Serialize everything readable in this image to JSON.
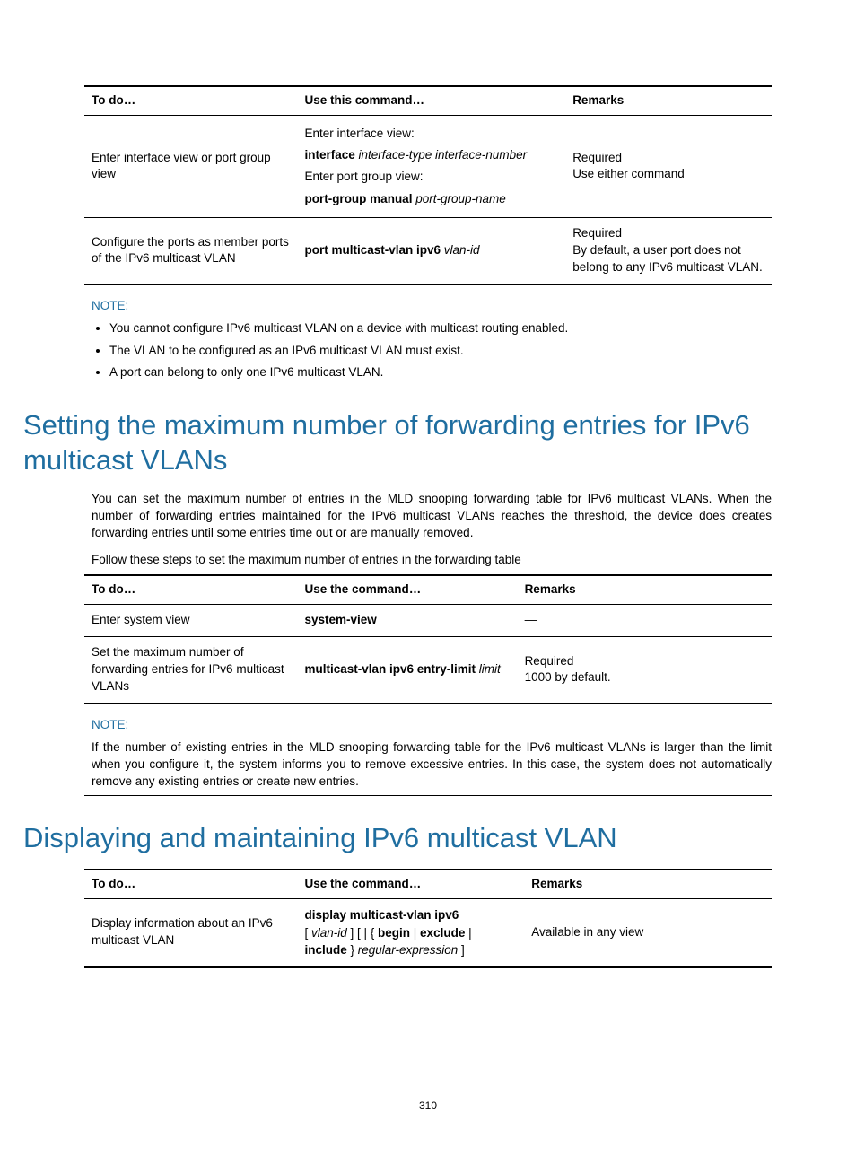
{
  "table1": {
    "headers": {
      "c1": "To do…",
      "c2": "Use this command…",
      "c3": "Remarks"
    },
    "row1": {
      "todo": "Enter interface view or port group view",
      "cmd_line1": "Enter interface view:",
      "cmd_bold2": "interface",
      "cmd_ital2": " interface-type interface-number",
      "cmd_line3": "Enter port group view:",
      "cmd_bold4": "port-group manual",
      "cmd_ital4": " port-group-name",
      "remarks_l1": "Required",
      "remarks_l2": "Use either command"
    },
    "row2": {
      "todo": "Configure the ports as member ports of the IPv6 multicast VLAN",
      "cmd_bold": "port multicast-vlan ipv6",
      "cmd_ital": " vlan-id",
      "remarks_l1": "Required",
      "remarks_l2": "By default, a user port does not belong to any IPv6 multicast VLAN."
    }
  },
  "note1": {
    "heading": "NOTE:",
    "b1": "You cannot configure IPv6 multicast VLAN on a device with multicast routing enabled.",
    "b2": "The VLAN to be configured as an IPv6 multicast VLAN must exist.",
    "b3": "A port can belong to only one IPv6 multicast VLAN."
  },
  "heading_setting": "Setting the maximum number of forwarding entries for IPv6 multicast VLANs",
  "para_setting": "You can set the maximum number of entries in the MLD snooping forwarding table for IPv6 multicast VLANs. When the number of forwarding entries maintained for the IPv6 multicast VLANs reaches the threshold, the device does creates forwarding entries until some entries time out or are manually removed.",
  "lead_setting": "Follow these steps to set the maximum number of entries in the forwarding table",
  "table2": {
    "headers": {
      "c1": "To do…",
      "c2": "Use the command…",
      "c3": "Remarks"
    },
    "row1": {
      "todo": "Enter system view",
      "cmd_bold": "system-view",
      "remarks": "—"
    },
    "row2": {
      "todo": "Set the maximum number of forwarding entries for IPv6 multicast VLANs",
      "cmd_bold": "multicast-vlan ipv6 entry-limit",
      "cmd_ital": " limit",
      "remarks_l1": "Required",
      "remarks_l2": "1000 by default."
    }
  },
  "note2": {
    "heading": "NOTE:",
    "text": "If the number of existing entries in the MLD snooping forwarding table for the IPv6 multicast VLANs is larger than the limit when you configure it, the system informs you to remove excessive entries. In this case, the system does not automatically remove any existing entries or create new entries."
  },
  "heading_display": "Displaying and maintaining IPv6 multicast VLAN",
  "table3": {
    "headers": {
      "c1": "To do…",
      "c2": "Use the command…",
      "c3": "Remarks"
    },
    "row1": {
      "todo": "Display information about an IPv6 multicast VLAN",
      "cmd_b1": "display multicast-vlan ipv6",
      "cmd_l2_p1": "[ ",
      "cmd_l2_it": "vlan-id",
      "cmd_l2_p2": " ] [ | { ",
      "cmd_l2_b1": "begin",
      "cmd_l2_p3": " | ",
      "cmd_l2_b2": "exclude",
      "cmd_l2_p4": " | ",
      "cmd_l3_b1": "include",
      "cmd_l3_p1": " } ",
      "cmd_l3_it": "regular-expression",
      "cmd_l3_p2": " ]",
      "remarks": "Available in any view"
    }
  },
  "page_number": "310"
}
